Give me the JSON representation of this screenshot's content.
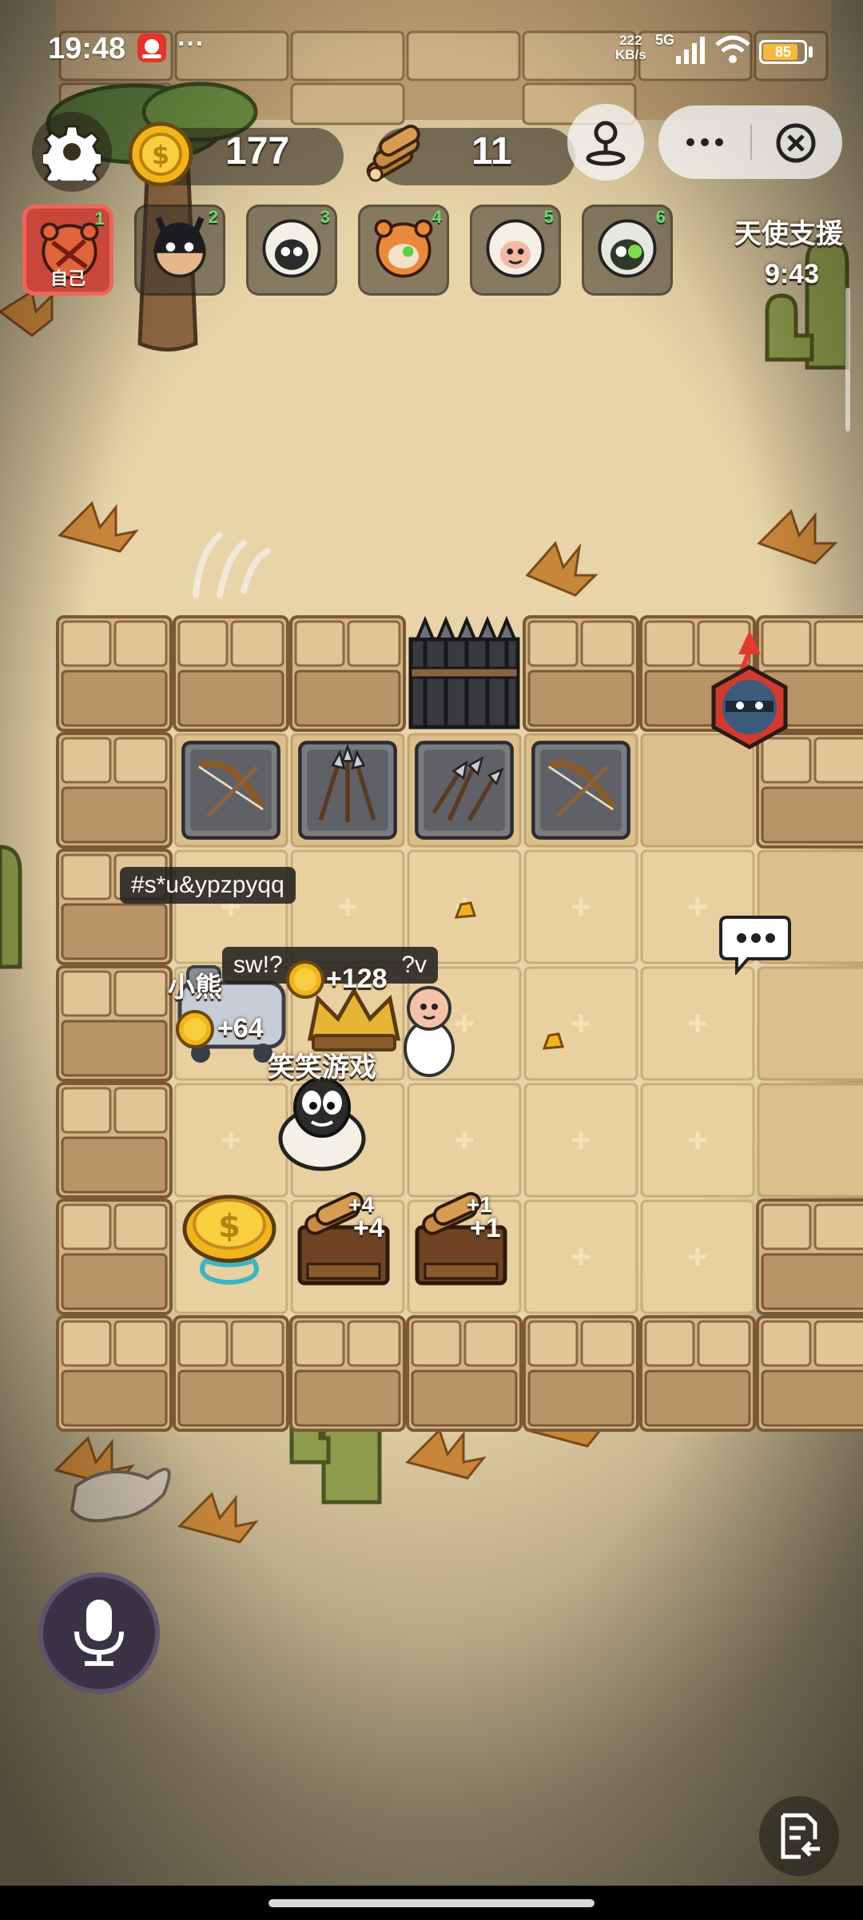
{
  "status_bar": {
    "time": "19:48",
    "more": "···",
    "net_speed_value": "222",
    "net_speed_unit": "KB/s",
    "network": "5G",
    "battery": "85",
    "battery_level": 0.85
  },
  "hud": {
    "coins": "177",
    "wood": "11"
  },
  "players": [
    {
      "rank": "1",
      "label": "自己",
      "avatar": "red-bear-avatar-icon"
    },
    {
      "rank": "2",
      "avatar": "masked-hero-avatar-icon"
    },
    {
      "rank": "3",
      "avatar": "dark-sheep-avatar-icon"
    },
    {
      "rank": "4",
      "avatar": "orange-bear-avatar-icon"
    },
    {
      "rank": "5",
      "avatar": "pink-sheep-avatar-icon"
    },
    {
      "rank": "6",
      "avatar": "zombie-sheep-avatar-icon"
    }
  ],
  "event": {
    "title": "天使支援",
    "timer": "9:43"
  },
  "board": {
    "name_tag_1": "#s*u&ypzpyqq",
    "name_tag_2": "sw!?",
    "name_tag_2_tail": "?v",
    "player_label_1": "小熊",
    "player_label_2": "笑笑游戏",
    "coin_gain_1": "+128",
    "coin_gain_2": "+64",
    "wood_gain_1_top": "+4",
    "wood_gain_1": "+4",
    "wood_gain_2_top": "+1",
    "wood_gain_2": "+1"
  },
  "colors": {
    "sand": "#e8d4a8",
    "stone": "#d8b98a",
    "floor": "#e7cfa0",
    "accent_red": "#c9473a",
    "rank_green": "#6dd870"
  }
}
